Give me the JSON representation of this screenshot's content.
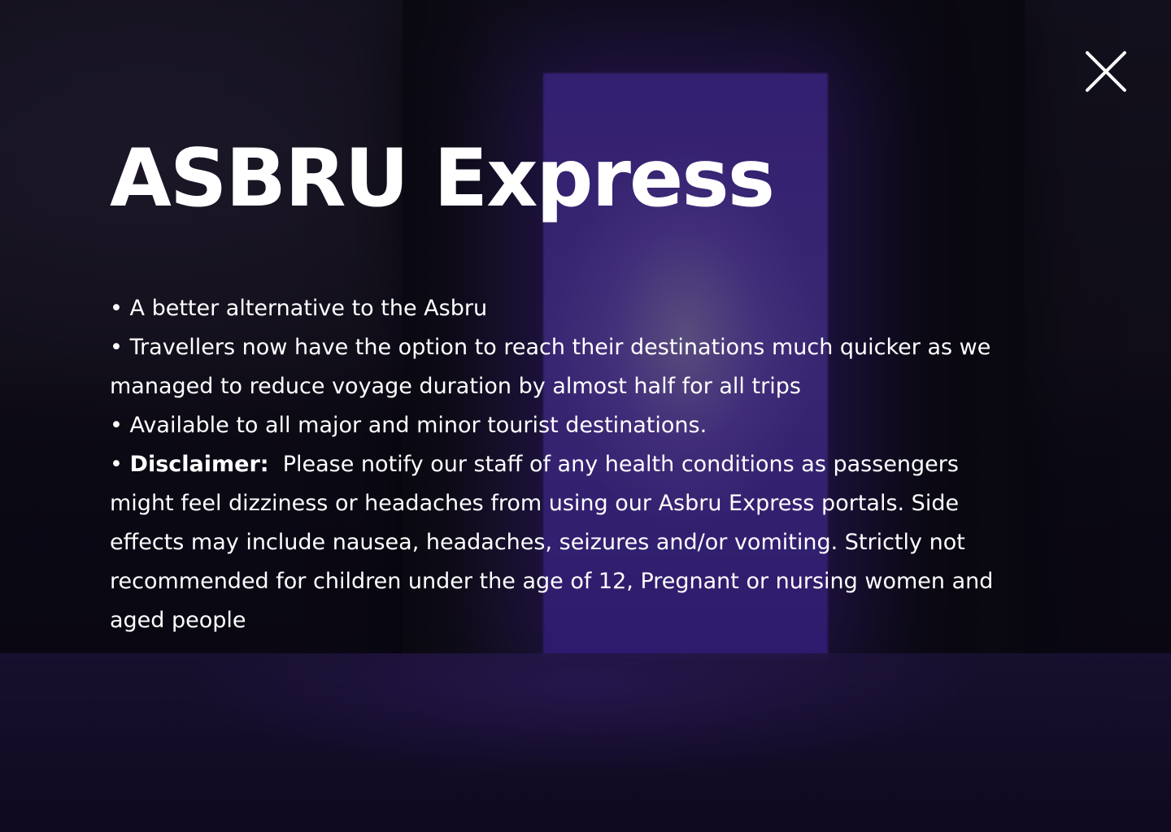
{
  "modal": {
    "title": "ASBRU Express",
    "bullet": "•",
    "items": [
      {
        "text": "A better alternative to the Asbru"
      },
      {
        "text": "Travellers now have the option to reach their destinations much quicker as we managed to reduce voyage duration by almost half for all trips"
      },
      {
        "text": "Available to all major and minor tourist destinations."
      },
      {
        "label": "Disclaimer:",
        "text": "Please notify our staff of any health conditions as passengers might feel dizziness or headaches from using our Asbru Express portals. Side effects may include nausea, headaches, seizures and/or vomiting. Strictly not recommended for children under the age of 12, Pregnant or nursing women and aged people"
      }
    ],
    "close_icon": "close-icon"
  },
  "colors": {
    "text": "#ffffff",
    "portal_glow": "#6e58c8",
    "background": "#0c0a1c"
  }
}
